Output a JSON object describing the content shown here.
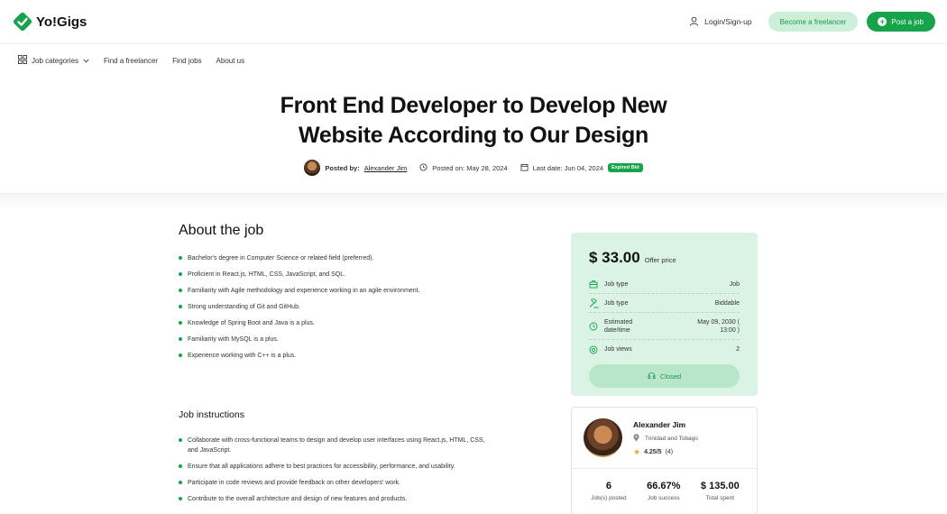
{
  "brand": {
    "name": "Yo!Gigs",
    "accent": "#16a34a"
  },
  "header": {
    "login_label": "Login/Sign-up",
    "become_freelancer_label": "Become a freelancer",
    "post_job_label": "Post a job"
  },
  "nav": {
    "items": [
      "Job categories",
      "Find a freelancer",
      "Find jobs",
      "About us"
    ]
  },
  "job": {
    "title": "Front End Developer to Develop New Website According to Our Design",
    "posted_by_label": "Posted by:",
    "author": "Alexander Jim",
    "posted_on": "Posted on: May 28, 2024",
    "last_date": "Last date: Jun 04, 2024",
    "status_badge": "Expired Bid"
  },
  "about": {
    "heading": "About the job",
    "items": [
      "Bachelor's degree in Computer Science or related field (preferred).",
      "Proficient in React.js, HTML, CSS, JavaScript, and SQL.",
      "Familiarity with Agile methodology and experience working in an agile environment.",
      "Strong understanding of Git and GitHub.",
      "Knowledge of Spring Boot and Java is a plus.",
      "Familiarity with MySQL is a plus.",
      "Experience working with C++ is a plus."
    ]
  },
  "instructions": {
    "heading": "Job instructions",
    "items": [
      "Collaborate with cross-functional teams to design and develop user interfaces using React.js, HTML, CSS, and JavaScript.",
      "Ensure that all applications adhere to best practices for accessibility, performance, and usability.",
      "Participate in code reviews and provide feedback on other developers' work.",
      "Contribute to the overall architecture and design of new features and products."
    ]
  },
  "offer": {
    "amount": "$ 33.00",
    "amount_label": "Offer price",
    "rows": [
      {
        "icon": "briefcase-icon",
        "label": "Job type",
        "value": "Job"
      },
      {
        "icon": "gavel-icon",
        "label": "Job type",
        "value": "Biddable"
      },
      {
        "icon": "clock-icon",
        "label": "Estimated date/time",
        "value": "May 09, 2030 ( 13:00 )"
      },
      {
        "icon": "eye-icon",
        "label": "Job views",
        "value": "2"
      }
    ],
    "closed_label": "Closed"
  },
  "client": {
    "name": "Alexander Jim",
    "location": "Trinidad and Tobago",
    "rating": "4.25/5",
    "rating_count": "(4)",
    "stats": [
      {
        "value": "6",
        "label": "Job(s) posted"
      },
      {
        "value": "66.67%",
        "label": "Job success"
      },
      {
        "value": "$ 135.00",
        "label": "Total spent"
      }
    ]
  }
}
